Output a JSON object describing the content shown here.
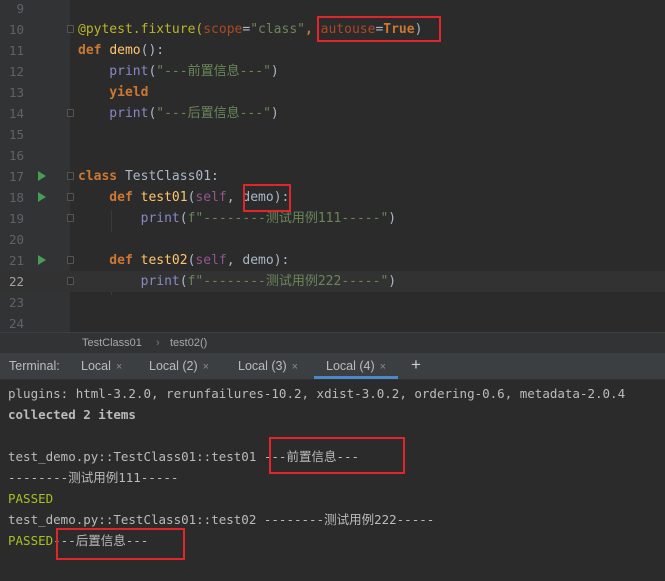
{
  "editor": {
    "lines": [
      {
        "num": "9",
        "tokens": []
      },
      {
        "num": "10",
        "tokens": [
          {
            "t": "@pytest.fixture(",
            "c": "dec"
          },
          {
            "t": "scope",
            "c": "param"
          },
          {
            "t": "=",
            "c": ""
          },
          {
            "t": "\"class\"",
            "c": "str"
          },
          {
            "t": ", ",
            "c": "kw"
          },
          {
            "t": "autouse",
            "c": "param"
          },
          {
            "t": "=",
            "c": ""
          },
          {
            "t": "True",
            "c": "kw"
          },
          {
            "t": ")",
            "c": ""
          }
        ]
      },
      {
        "num": "11",
        "tokens": [
          {
            "t": "def ",
            "c": "kw"
          },
          {
            "t": "demo",
            "c": "fn"
          },
          {
            "t": "():",
            "c": ""
          }
        ]
      },
      {
        "num": "12",
        "tokens": [
          {
            "t": "    print",
            "c": "bi"
          },
          {
            "t": "(",
            "c": ""
          },
          {
            "t": "\"---前置信息---\"",
            "c": "str"
          },
          {
            "t": ")",
            "c": ""
          }
        ]
      },
      {
        "num": "13",
        "tokens": [
          {
            "t": "    yield",
            "c": "kw"
          }
        ]
      },
      {
        "num": "14",
        "tokens": [
          {
            "t": "    print",
            "c": "bi"
          },
          {
            "t": "(",
            "c": ""
          },
          {
            "t": "\"---后置信息---\"",
            "c": "str"
          },
          {
            "t": ")",
            "c": ""
          }
        ]
      },
      {
        "num": "15",
        "tokens": []
      },
      {
        "num": "16",
        "tokens": []
      },
      {
        "num": "17",
        "tokens": [
          {
            "t": "class ",
            "c": "kw"
          },
          {
            "t": "TestClass01:",
            "c": ""
          }
        ]
      },
      {
        "num": "18",
        "tokens": [
          {
            "t": "    def ",
            "c": "kw"
          },
          {
            "t": "test01",
            "c": "fn"
          },
          {
            "t": "(",
            "c": ""
          },
          {
            "t": "self",
            "c": "self"
          },
          {
            "t": ", demo):",
            "c": ""
          }
        ]
      },
      {
        "num": "19",
        "tokens": [
          {
            "t": "        print",
            "c": "bi"
          },
          {
            "t": "(",
            "c": ""
          },
          {
            "t": "f\"--------测试用例111-----\"",
            "c": "str"
          },
          {
            "t": ")",
            "c": ""
          }
        ]
      },
      {
        "num": "20",
        "tokens": []
      },
      {
        "num": "21",
        "tokens": [
          {
            "t": "    def ",
            "c": "kw"
          },
          {
            "t": "test02",
            "c": "fn"
          },
          {
            "t": "(",
            "c": ""
          },
          {
            "t": "self",
            "c": "self"
          },
          {
            "t": ", demo):",
            "c": ""
          }
        ]
      },
      {
        "num": "22",
        "tokens": [
          {
            "t": "        print",
            "c": "bi"
          },
          {
            "t": "(",
            "c": ""
          },
          {
            "t": "f\"--------测试用例222-----\"",
            "c": "str"
          },
          {
            "t": ")",
            "c": ""
          }
        ]
      },
      {
        "num": "23",
        "tokens": []
      },
      {
        "num": "24",
        "tokens": []
      }
    ]
  },
  "breadcrumb": {
    "class_name": "TestClass01",
    "separator": "›",
    "method": "test02()"
  },
  "terminal": {
    "label": "Terminal:",
    "tabs": [
      "Local",
      "Local (2)",
      "Local (3)",
      "Local (4)"
    ],
    "close_glyph": "×",
    "add_glyph": "+",
    "output": {
      "plugins": "plugins: html-3.2.0, rerunfailures-10.2, xdist-3.0.2, ordering-0.6, metadata-2.0.4",
      "collected": "collected 2 items",
      "test01": "test_demo.py::TestClass01::test01",
      "pre_info": " ---前置信息---",
      "case111": "--------测试用例111-----",
      "passed": "PASSED",
      "test02": "test_demo.py::TestClass01::test02 --------测试用例222-----",
      "post_info": "---后置信息---"
    }
  },
  "colors": {
    "highlight_box": "#e0262b",
    "run_icon": "#499c54",
    "active_tab": "#4a88c7",
    "passed": "#a8c023"
  }
}
